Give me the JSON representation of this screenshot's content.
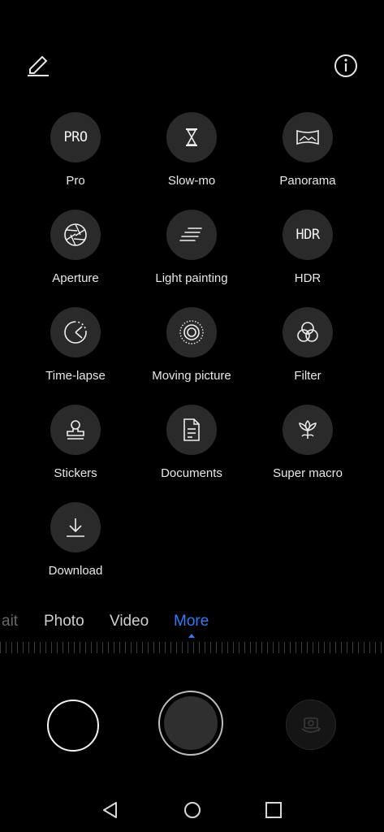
{
  "topbar": {
    "edit_icon": "pencil-icon",
    "info_icon": "info-icon"
  },
  "modes": [
    {
      "label": "Pro",
      "icon_text": "PRO"
    },
    {
      "label": "Slow-mo",
      "icon": "hourglass-icon"
    },
    {
      "label": "Panorama",
      "icon": "panorama-icon"
    },
    {
      "label": "Aperture",
      "icon": "aperture-icon"
    },
    {
      "label": "Light painting",
      "icon": "light-painting-icon"
    },
    {
      "label": "HDR",
      "icon_text": "HDR"
    },
    {
      "label": "Time-lapse",
      "icon": "timelapse-icon"
    },
    {
      "label": "Moving picture",
      "icon": "moving-picture-icon"
    },
    {
      "label": "Filter",
      "icon": "filter-icon"
    },
    {
      "label": "Stickers",
      "icon": "stamp-icon"
    },
    {
      "label": "Documents",
      "icon": "document-icon"
    },
    {
      "label": "Super macro",
      "icon": "flower-icon"
    },
    {
      "label": "Download",
      "icon": "download-icon"
    }
  ],
  "tabs": {
    "portrait": "ait",
    "photo": "Photo",
    "video": "Video",
    "more": "More"
  },
  "colors": {
    "accent": "#2f7bf5",
    "background": "#000000",
    "circle": "#2a2a2a"
  }
}
